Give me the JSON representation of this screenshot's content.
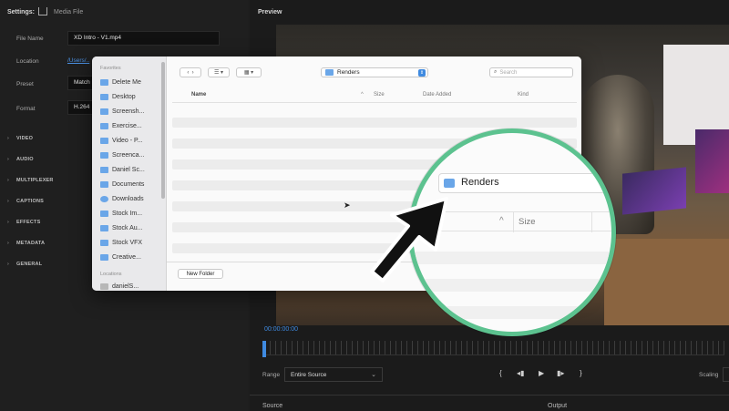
{
  "settings": {
    "title": "Settings:",
    "media_file_label": "Media File",
    "fields": {
      "file_name_label": "File Name",
      "file_name_value": "XD Intro - V1.mp4",
      "location_label": "Location",
      "location_value": "/Users/..",
      "preset_label": "Preset",
      "preset_value": "Match",
      "format_label": "Format",
      "format_value": "H.264"
    },
    "sections": [
      "VIDEO",
      "AUDIO",
      "MULTIPLEXER",
      "CAPTIONS",
      "EFFECTS",
      "METADATA",
      "GENERAL"
    ]
  },
  "preview": {
    "title": "Preview",
    "timecode": "00:00:00:00",
    "range_label": "Range",
    "range_value": "Entire Source",
    "scaling_label": "Scaling",
    "source_label": "Source",
    "output_label": "Output"
  },
  "dialog": {
    "sidebar": {
      "favorites_header": "Favorites",
      "items": [
        "Delete Me",
        "Desktop",
        "Screensh...",
        "Exercise...",
        "Video - P...",
        "Screenca...",
        "Daniel Sc...",
        "Documents",
        "Downloads",
        "Stock Im...",
        "Stock Au...",
        "Stock VFX",
        "Creative..."
      ],
      "locations_header": "Locations",
      "location_items": [
        "danielS..."
      ]
    },
    "folder_name": "Renders",
    "search_placeholder": "Search",
    "columns": {
      "name": "Name",
      "size": "Size",
      "date_added": "Date Added",
      "kind": "Kind"
    },
    "new_folder_button": "New Folder"
  },
  "zoom_callout": {
    "folder_name": "Renders",
    "size_column": "Size",
    "ring_color": "#5cc28f"
  },
  "colors": {
    "accent_blue": "#3f8ae0",
    "folder_blue": "#6aa6e8"
  }
}
